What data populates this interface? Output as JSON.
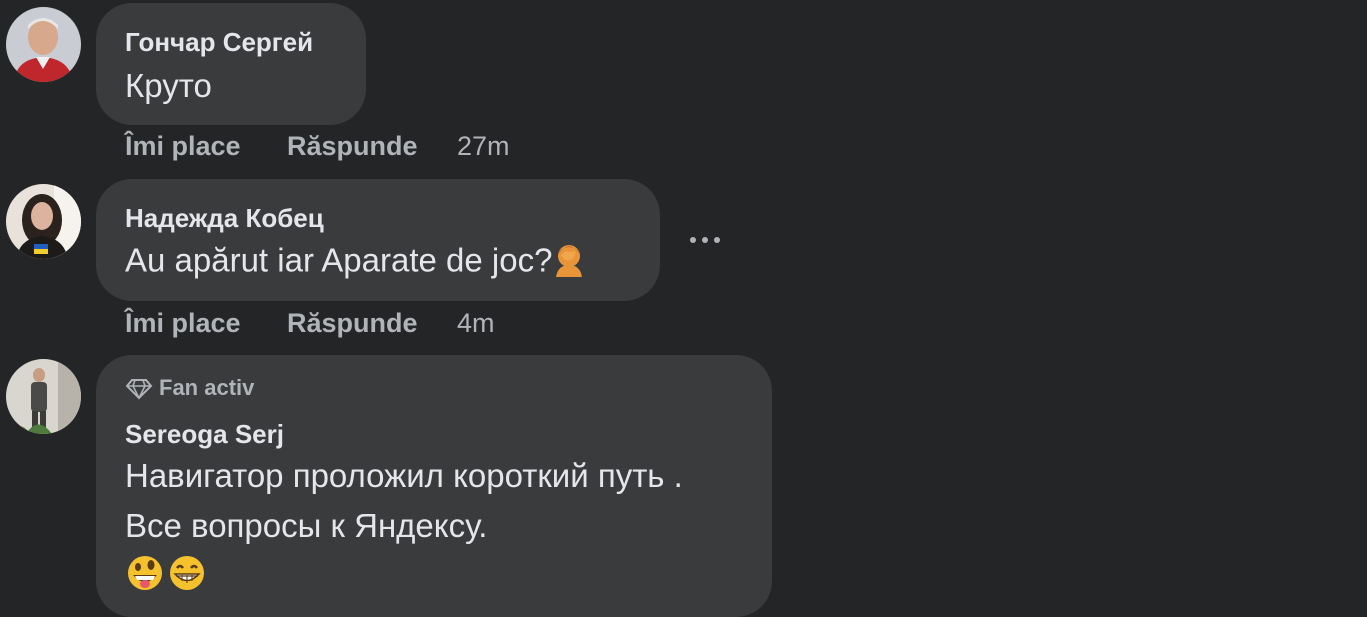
{
  "comments": [
    {
      "author": "Гончар Сергей",
      "text": "Круто",
      "like_label": "Îmi place",
      "reply_label": "Răspunde",
      "time": "27m"
    },
    {
      "author": "Надежда Кобец",
      "text": "Au apărut iar Aparate de joc?",
      "like_label": "Îmi place",
      "reply_label": "Răspunde",
      "time": "4m"
    },
    {
      "badge": "Fan activ",
      "author": "Sereoga Serj",
      "text_line1": "Навигатор проложил короткий путь .",
      "text_line2": "Все вопросы к Яндексу."
    }
  ],
  "icons": {
    "comment2_emoji": "facepalm-emoji",
    "comment3_emojis": [
      "grinning-tongue-emoji",
      "grinning-teeth-emoji"
    ],
    "badge_icon": "diamond-icon",
    "more_icon": "more-horizontal-icon"
  },
  "colors": {
    "background": "#242526",
    "bubble": "#3a3b3c",
    "primary_text": "#e4e6eb",
    "secondary_text": "#b0b3b8"
  }
}
